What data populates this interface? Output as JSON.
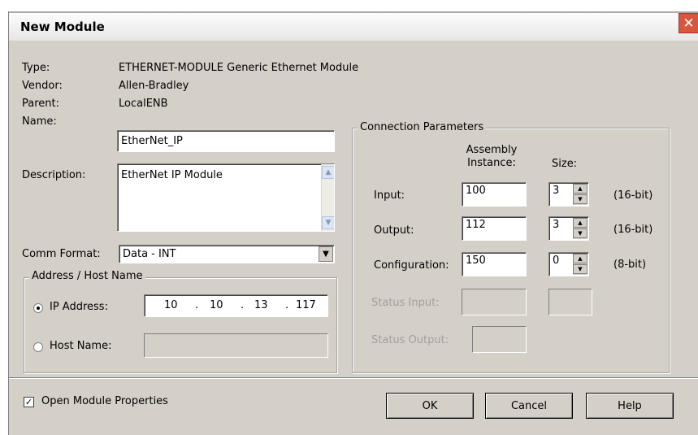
{
  "window": {
    "title": "New Module",
    "close_icon": "close-icon"
  },
  "info": {
    "type_label": "Type:",
    "type_value": "ETHERNET-MODULE Generic Ethernet Module",
    "vendor_label": "Vendor:",
    "vendor_value": "Allen-Bradley",
    "parent_label": "Parent:",
    "parent_value": "LocalENB"
  },
  "name": {
    "label": "Name:",
    "value": "EtherNet_IP"
  },
  "description": {
    "label": "Description:",
    "value": "EtherNet IP Module"
  },
  "comm_format": {
    "label": "Comm Format:",
    "value": "Data - INT"
  },
  "address": {
    "group_title": "Address / Host Name",
    "ip_label": "IP Address:",
    "ip_octets": [
      "10",
      "10",
      "13",
      "117"
    ],
    "host_label": "Host Name:",
    "host_value": "",
    "selected": "ip"
  },
  "connection": {
    "group_title": "Connection Parameters",
    "assembly_header": "Assembly Instance:",
    "size_header": "Size:",
    "rows": [
      {
        "label": "Input:",
        "instance": "100",
        "size": "3",
        "unit": "(16-bit)"
      },
      {
        "label": "Output:",
        "instance": "112",
        "size": "3",
        "unit": "(16-bit)"
      },
      {
        "label": "Configuration:",
        "instance": "150",
        "size": "0",
        "unit": "(8-bit)"
      }
    ],
    "status_input_label": "Status Input:",
    "status_output_label": "Status Output:"
  },
  "footer": {
    "open_props_label": "Open Module Properties",
    "open_props_checked": true,
    "ok_label": "OK",
    "cancel_label": "Cancel",
    "help_label": "Help"
  }
}
